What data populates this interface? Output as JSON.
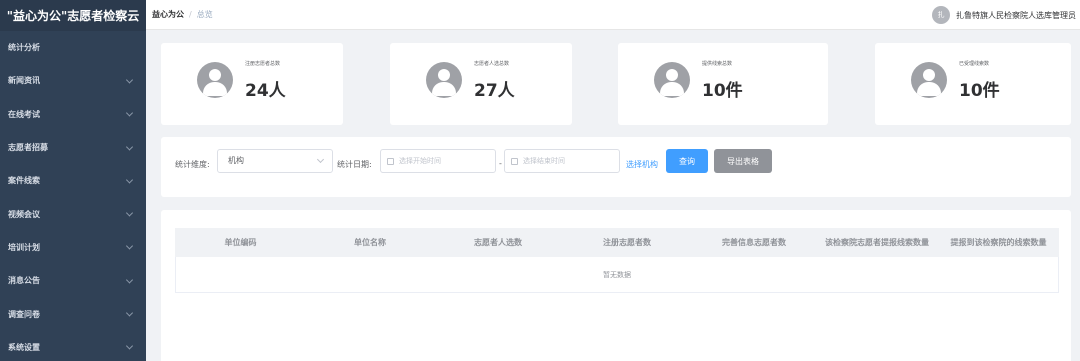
{
  "app": {
    "brand": "\"益心为公\"志愿者检察云"
  },
  "sidebar": {
    "items": [
      {
        "label": "统计分析",
        "has_children": false
      },
      {
        "label": "新闻资讯",
        "has_children": true
      },
      {
        "label": "在线考试",
        "has_children": true
      },
      {
        "label": "志愿者招募",
        "has_children": true
      },
      {
        "label": "案件线索",
        "has_children": true
      },
      {
        "label": "视频会议",
        "has_children": true
      },
      {
        "label": "培训计划",
        "has_children": true
      },
      {
        "label": "消息公告",
        "has_children": true
      },
      {
        "label": "调查问卷",
        "has_children": true
      },
      {
        "label": "系统设置",
        "has_children": true
      }
    ]
  },
  "header": {
    "breadcrumb": {
      "root": "益心为公",
      "separator": "/",
      "current": "总览"
    },
    "user": {
      "avatar_text": "扎",
      "name": "扎鲁特旗人民检察院人选库管理员"
    }
  },
  "stats": [
    {
      "label": "注册志愿者总数",
      "value": "24人"
    },
    {
      "label": "志愿者人选总数",
      "value": "27人"
    },
    {
      "label": "提供线索总数",
      "value": "10件"
    },
    {
      "label": "已受理线索数",
      "value": "10件"
    }
  ],
  "filter": {
    "dimension_label": "统计维度:",
    "dimension_value": "机构",
    "date_label": "统计日期:",
    "start_placeholder": "选择开始时间",
    "range_separator": "-",
    "end_placeholder": "选择结束时间",
    "select_org_link": "选择机构",
    "query_button": "查询",
    "export_button": "导出表格"
  },
  "table": {
    "columns": [
      "单位编码",
      "单位名称",
      "志愿者人选数",
      "注册志愿者数",
      "完善信息志愿者数",
      "该检察院志愿者提报线索数量",
      "提报到该检察院的线索数量"
    ],
    "rows": [],
    "empty_text": "暂无数据"
  },
  "colors": {
    "sidebar_bg": "#304156",
    "primary": "#409eff",
    "gray_button": "#909399",
    "page_bg": "#f0f2f5"
  }
}
